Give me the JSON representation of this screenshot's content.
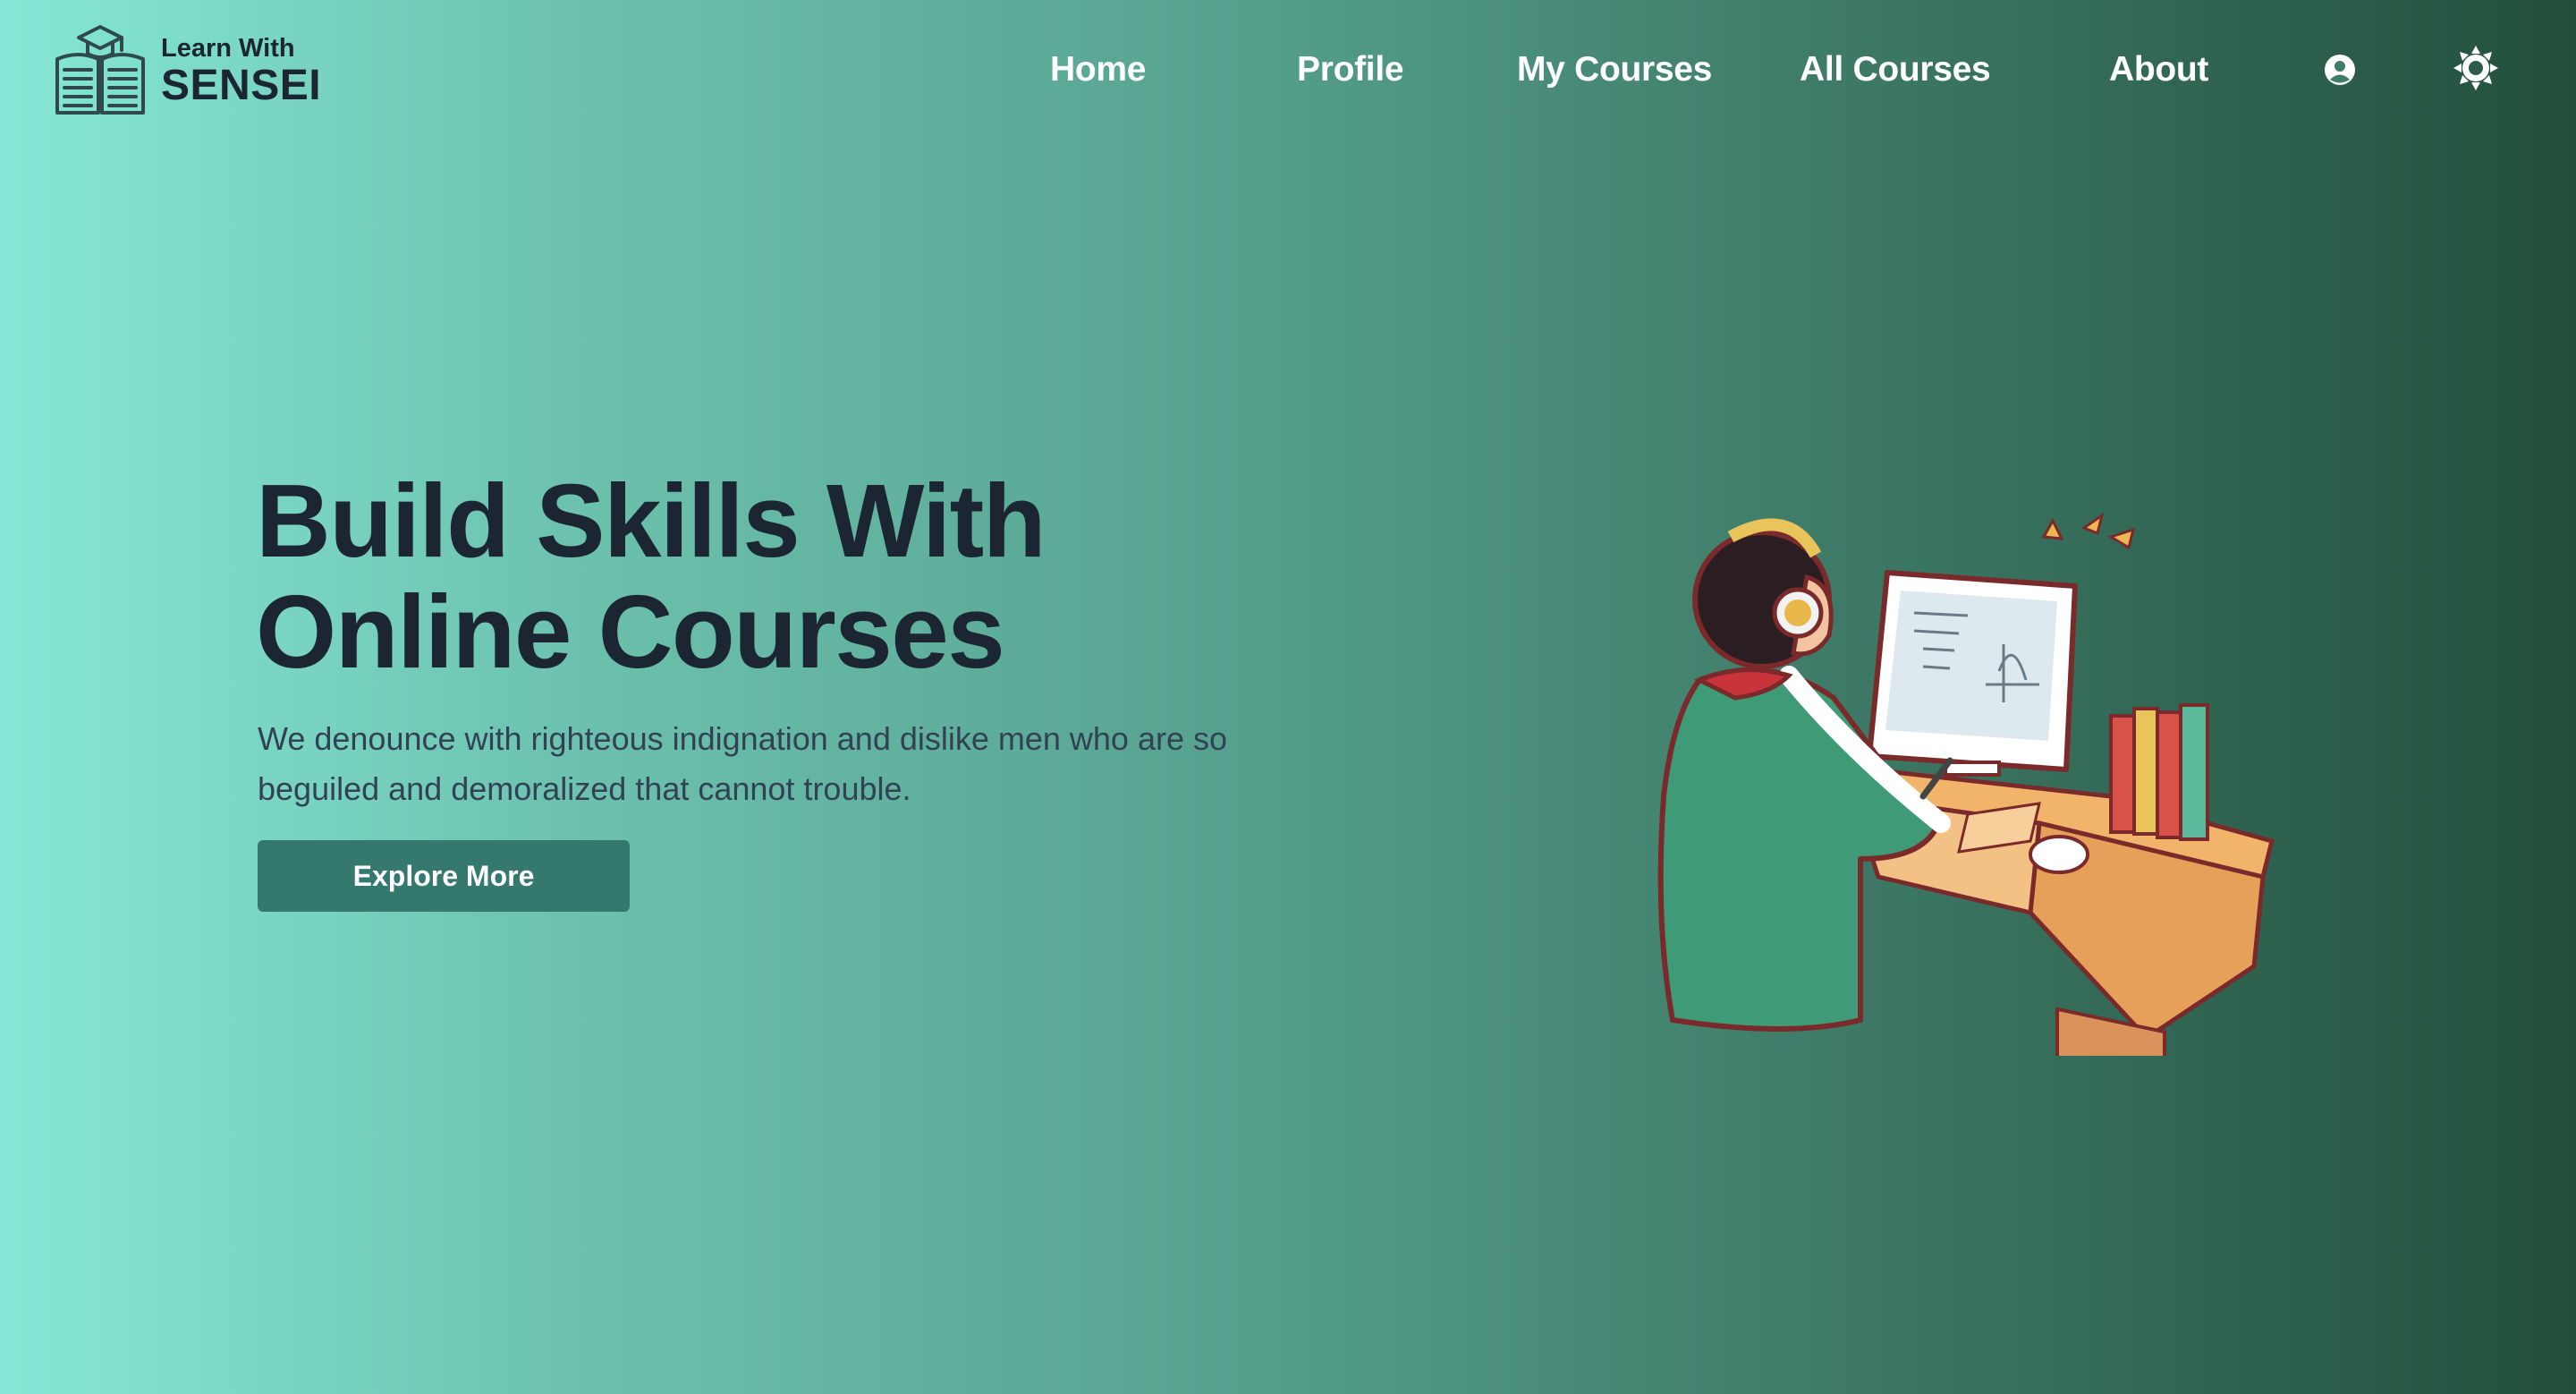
{
  "brand": {
    "line1": "Learn With",
    "line2": "SENSEI",
    "logo_icon": "open-book-graduation-cap-icon"
  },
  "nav": {
    "items": [
      {
        "label": "Home"
      },
      {
        "label": "Profile"
      },
      {
        "label": "My Courses"
      },
      {
        "label": "All Courses"
      },
      {
        "label": "About"
      }
    ],
    "account_icon": "user-circle-icon",
    "theme_icon": "sun-gear-icon"
  },
  "hero": {
    "title_line1": "Build Skills With",
    "title_line2": "Online Courses",
    "description": "We denounce with righteous indignation and dislike men who are so beguiled and demoralized that cannot trouble.",
    "cta_label": "Explore More",
    "illustration": "student-at-computer-illustration"
  },
  "colors": {
    "gradient_start": "#86e8d6",
    "gradient_end": "#224f3c",
    "heading": "#1c2633",
    "button": "#35786d"
  }
}
